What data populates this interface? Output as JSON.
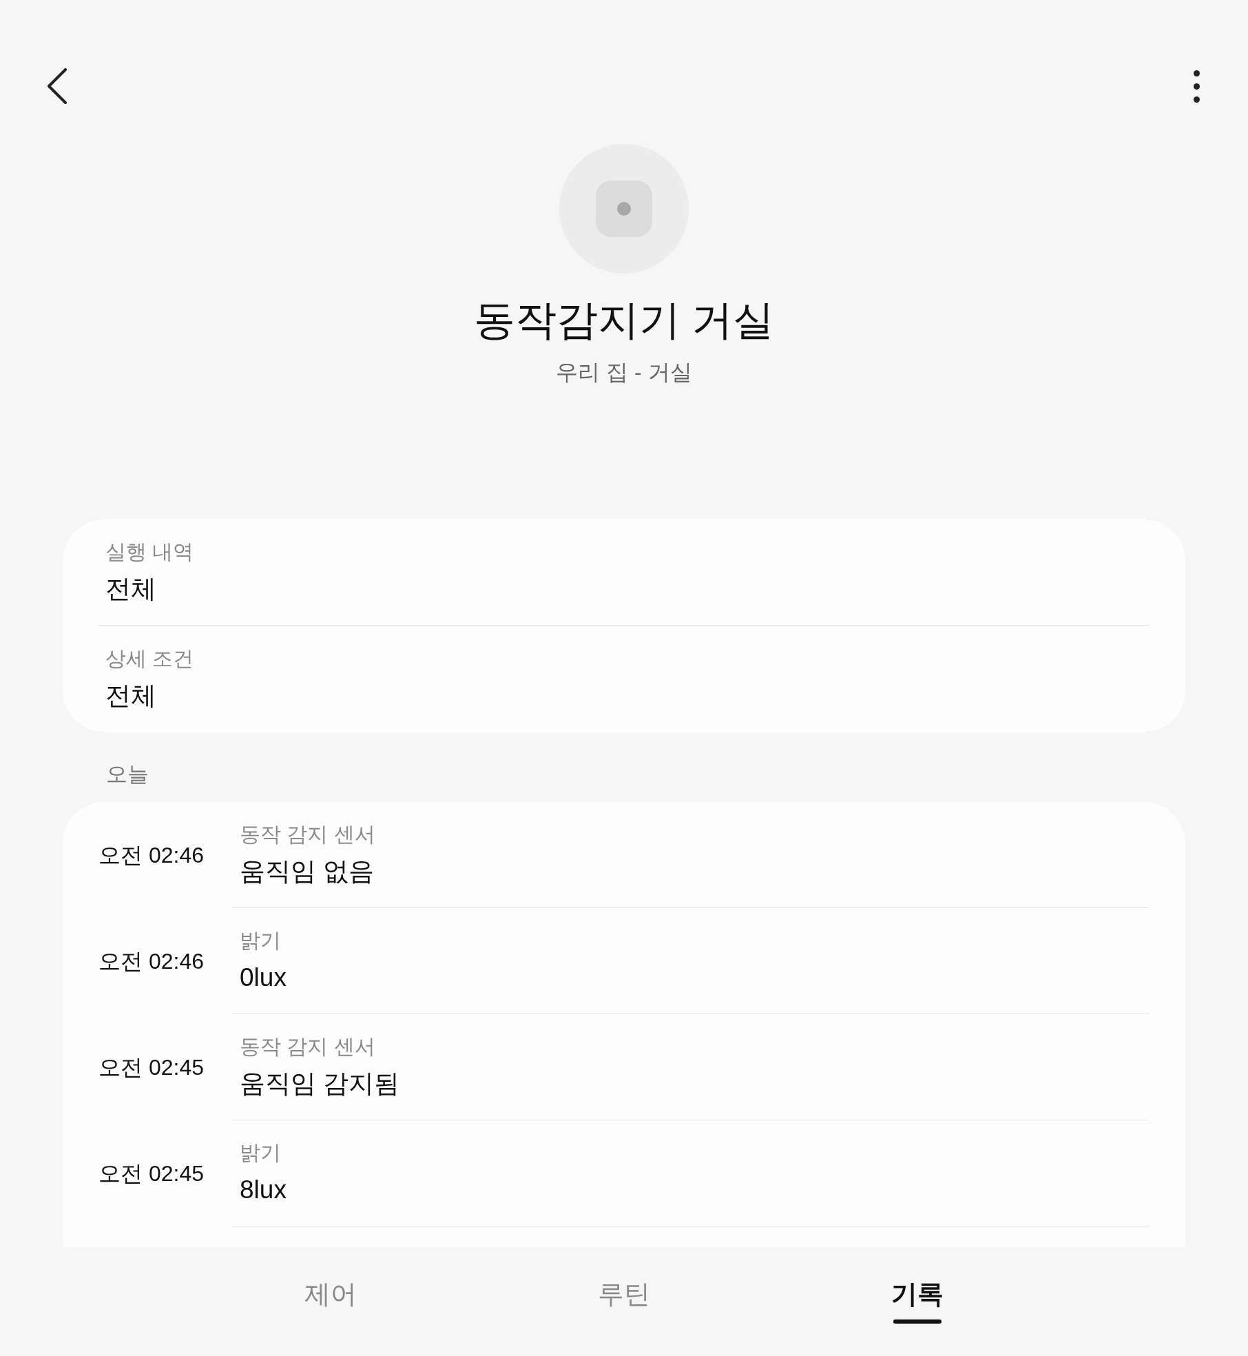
{
  "header": {
    "title": "동작감지기 거실",
    "subtitle": "우리 집 - 거실"
  },
  "filters": [
    {
      "label": "실행 내역",
      "value": "전체"
    },
    {
      "label": "상세 조건",
      "value": "전체"
    }
  ],
  "section": "오늘",
  "history": [
    {
      "time": "오전 02:46",
      "label": "동작 감지 센서",
      "value": "움직임 없음"
    },
    {
      "time": "오전 02:46",
      "label": "밝기",
      "value": "0lux"
    },
    {
      "time": "오전 02:45",
      "label": "동작 감지 센서",
      "value": "움직임 감지됨"
    },
    {
      "time": "오전 02:45",
      "label": "밝기",
      "value": "8lux"
    }
  ],
  "tabs": [
    {
      "label": "제어",
      "selected": false
    },
    {
      "label": "루틴",
      "selected": false
    },
    {
      "label": "기록",
      "selected": true
    }
  ]
}
